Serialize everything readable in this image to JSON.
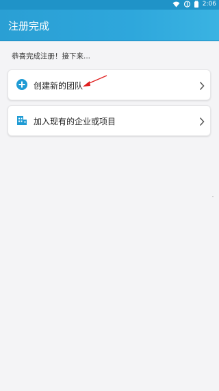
{
  "status_bar": {
    "time": "2:06"
  },
  "header": {
    "title": "注册完成"
  },
  "intro": {
    "text": "恭喜完成注册！接下来..."
  },
  "options": [
    {
      "label": "创建新的团队",
      "icon": "plus-circle-icon"
    },
    {
      "label": "加入现有的企业或项目",
      "icon": "building-icon"
    }
  ],
  "colors": {
    "header_bg": "#2ea7dc",
    "accent": "#1f9bd4",
    "annotation_arrow": "#e02020",
    "background": "#f4f4f6"
  }
}
